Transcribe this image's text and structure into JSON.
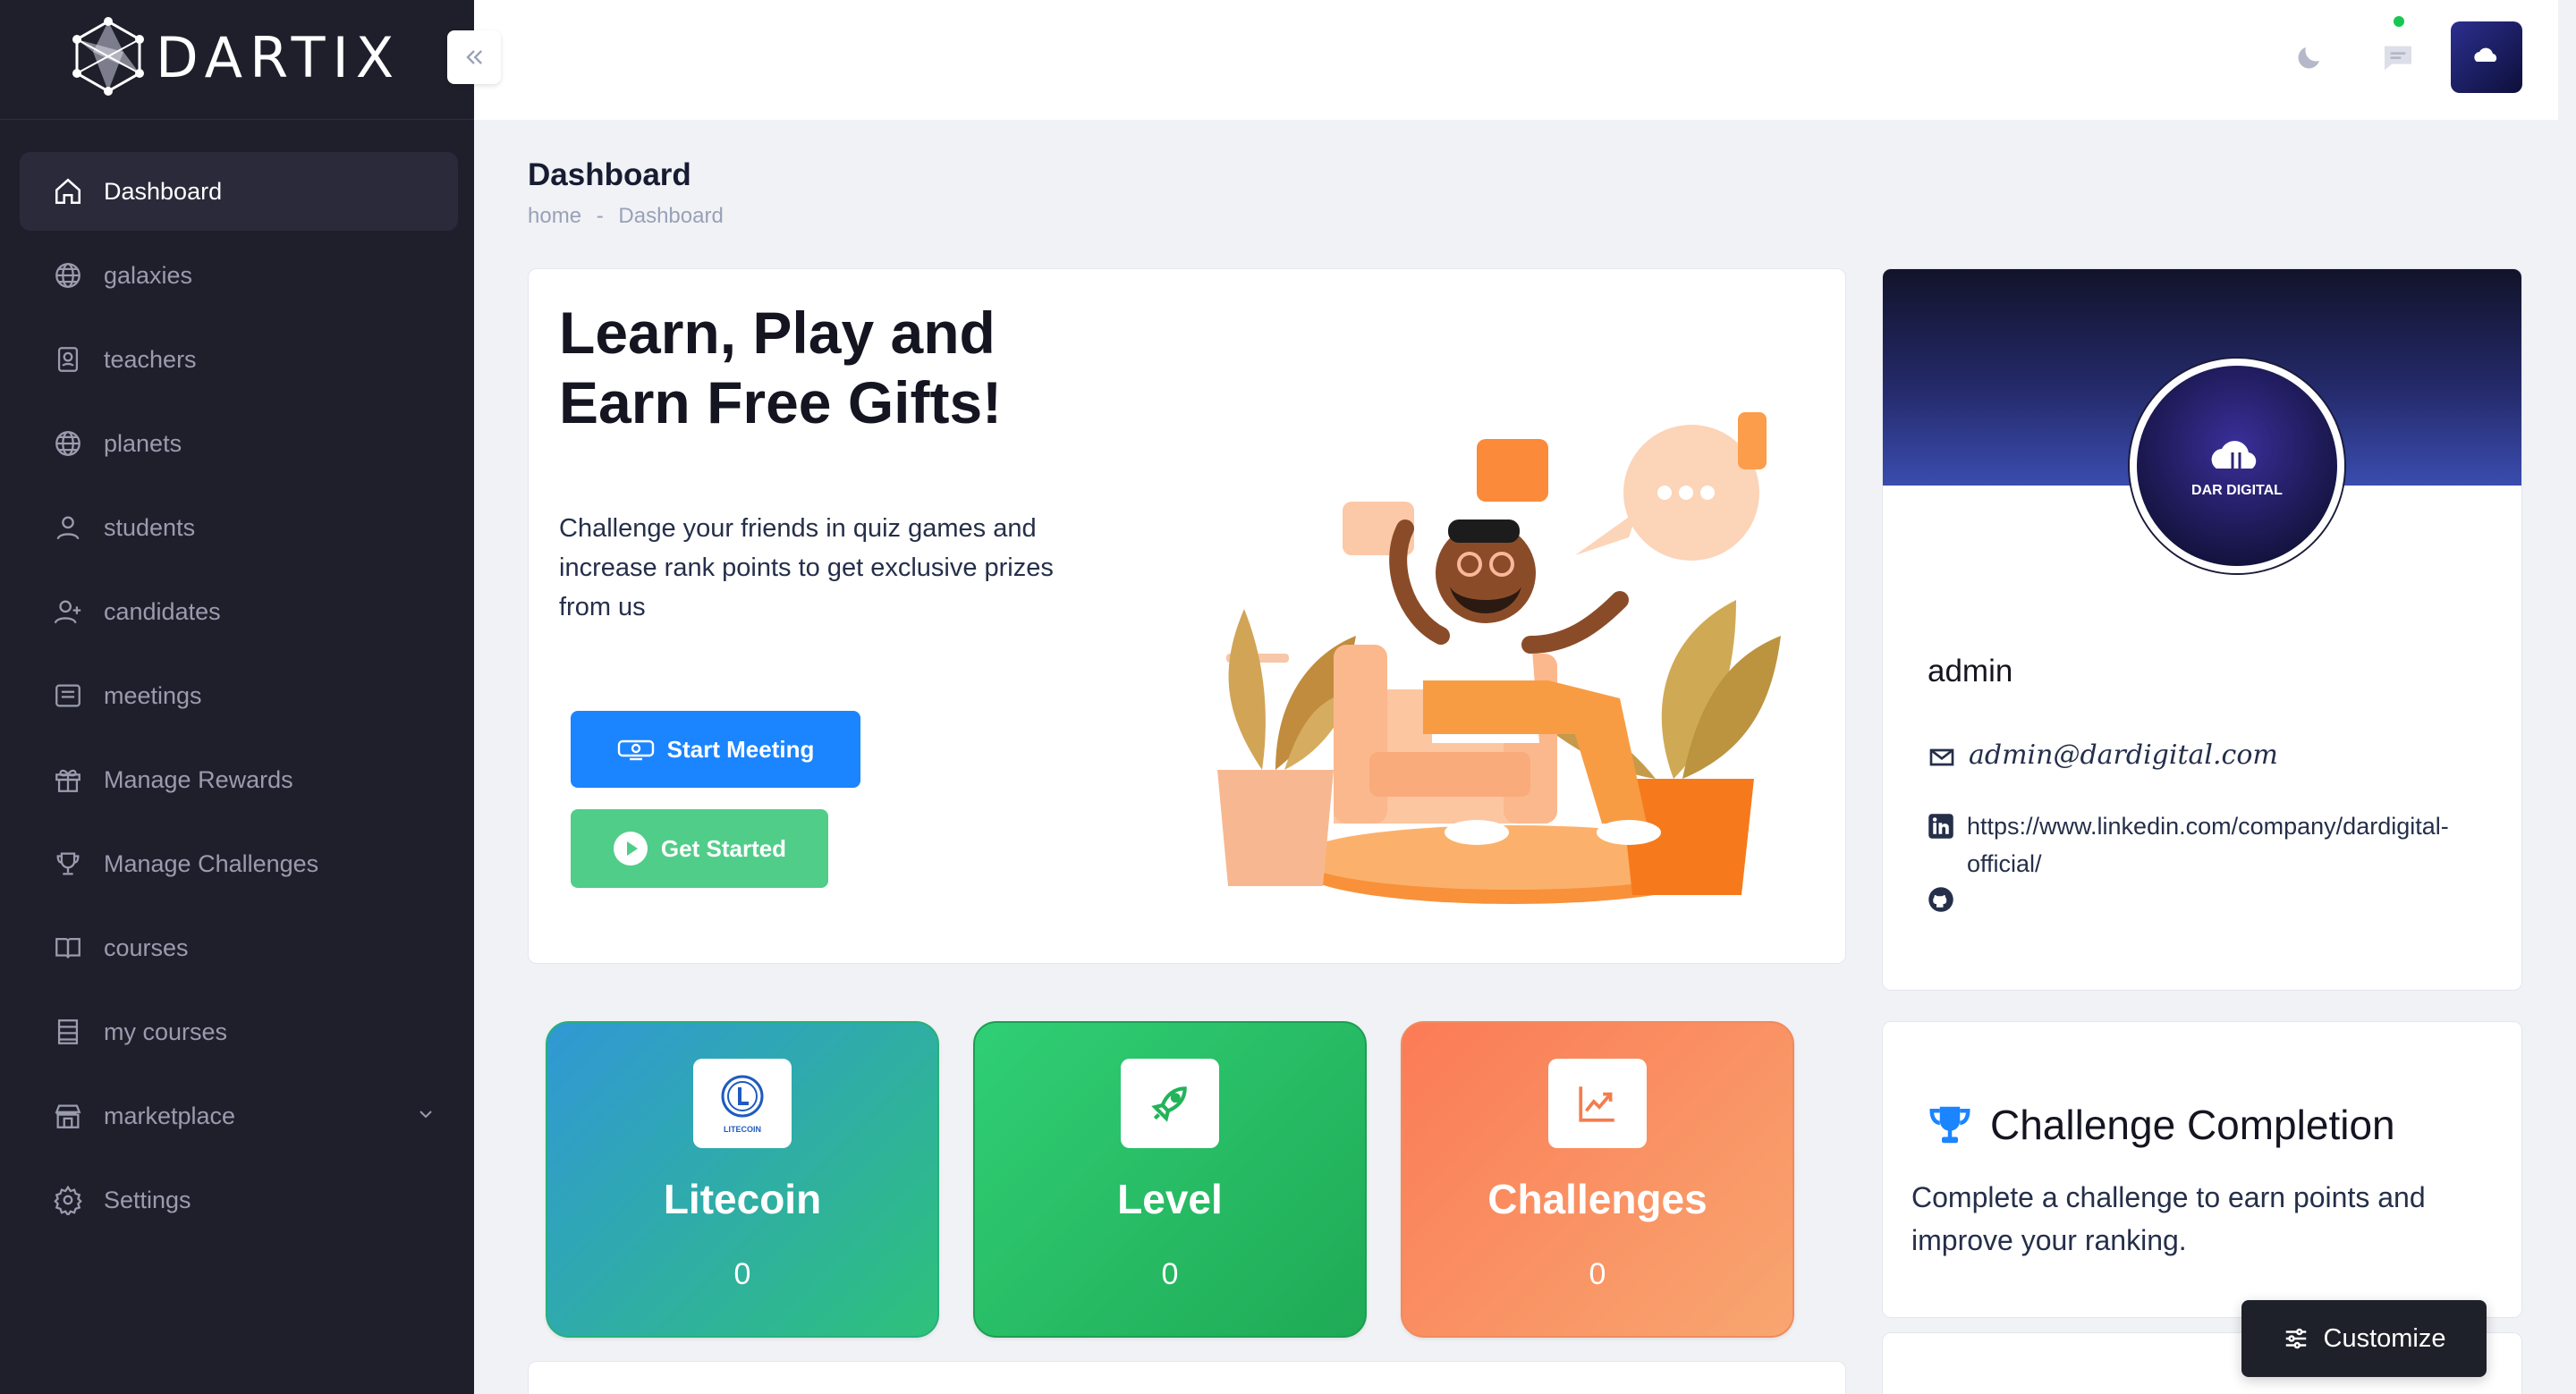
{
  "brand": {
    "name": "DARTIX"
  },
  "sidebar": {
    "items": [
      {
        "label": "Dashboard",
        "icon": "home-icon"
      },
      {
        "label": "galaxies",
        "icon": "globe-icon"
      },
      {
        "label": "teachers",
        "icon": "badge-icon"
      },
      {
        "label": "planets",
        "icon": "globe-icon"
      },
      {
        "label": "students",
        "icon": "user-icon"
      },
      {
        "label": "candidates",
        "icon": "user-plus-icon"
      },
      {
        "label": "meetings",
        "icon": "message-square-icon"
      },
      {
        "label": "Manage Rewards",
        "icon": "gift-icon"
      },
      {
        "label": "Manage Challenges",
        "icon": "trophy-icon"
      },
      {
        "label": "courses",
        "icon": "book-icon"
      },
      {
        "label": "my courses",
        "icon": "list-icon"
      },
      {
        "label": "marketplace",
        "icon": "shop-icon"
      },
      {
        "label": "Settings",
        "icon": "gear-icon"
      }
    ]
  },
  "page": {
    "title": "Dashboard",
    "breadcrumb": {
      "home": "home",
      "sep": "-",
      "current": "Dashboard"
    }
  },
  "hero": {
    "title": "Learn, Play and Earn Free Gifts!",
    "description": "Challenge your friends in quiz games and increase rank points to get exclusive prizes from us",
    "start_meeting_label": "Start Meeting",
    "get_started_label": "Get Started"
  },
  "stats": [
    {
      "label": "Litecoin",
      "value": "0",
      "icon": "litecoin-icon",
      "icon_caption": "LITECOIN"
    },
    {
      "label": "Level",
      "value": "0",
      "icon": "rocket-icon"
    },
    {
      "label": "Challenges",
      "value": "0",
      "icon": "chart-icon"
    }
  ],
  "profile": {
    "avatar_caption": "DAR DIGITAL",
    "name": "admin",
    "email": "admin@dardigital.com",
    "linkedin": "https://www.linkedin.com/company/dardigital-official/"
  },
  "challenge": {
    "title": "Challenge Completion",
    "description": "Complete a challenge to earn points and improve your ranking."
  },
  "customize_label": "Customize",
  "colors": {
    "sidebar_bg": "#1f1f2c",
    "primary": "#1b84ff",
    "success": "#50cd89",
    "notification_dot": "#17c653"
  }
}
